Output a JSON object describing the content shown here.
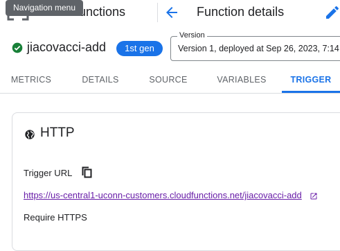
{
  "header": {
    "tooltip": "Navigation menu",
    "section_title": "unctions",
    "page_title": "Function details"
  },
  "function": {
    "name": "jiacovacci-add",
    "status": "active",
    "generation_badge": "1st gen"
  },
  "version": {
    "label": "Version",
    "value": "Version 1, deployed at Sep 26, 2023, 7:14"
  },
  "tabs": [
    {
      "label": "METRICS",
      "active": false
    },
    {
      "label": "DETAILS",
      "active": false
    },
    {
      "label": "SOURCE",
      "active": false
    },
    {
      "label": "VARIABLES",
      "active": false
    },
    {
      "label": "TRIGGER",
      "active": true
    }
  ],
  "trigger": {
    "type": "HTTP",
    "url_label": "Trigger URL",
    "url": "https://us-central1-uconn-customers.cloudfunctions.net/jiacovacci-add",
    "https_setting_label": "Require HTTPS"
  },
  "icons": {
    "nav": "menu-icon",
    "back": "arrow-back-icon",
    "edit": "edit-icon",
    "status": "check-circle-icon",
    "trigger_type": "globe-icon",
    "copy": "copy-icon",
    "external": "open-in-new-icon"
  },
  "colors": {
    "accent": "#1a73e8",
    "success": "#188038",
    "visited_link": "#681da8"
  }
}
